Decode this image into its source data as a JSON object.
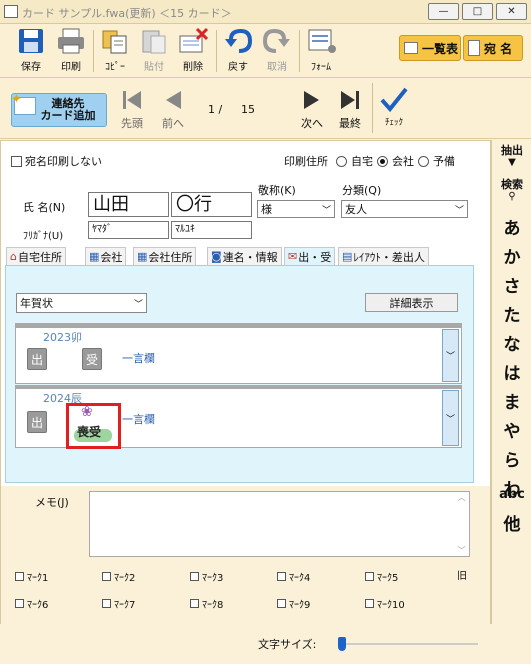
{
  "window": {
    "title": "カード サンプル.fwa(更新)  ＜15 カード＞",
    "min": "—",
    "max": "□",
    "close": "✕"
  },
  "toolbar": {
    "save": "保存",
    "print": "印刷",
    "copy": "ｺﾋﾟｰ",
    "paste": "貼付",
    "delete": "削除",
    "undo": "戻す",
    "redo": "取消",
    "form": "ﾌｫｰﾑ",
    "list_view": "一覧表",
    "address_name": "宛 名"
  },
  "nav": {
    "add_card": "連絡先\nカード追加",
    "first": "先頭",
    "prev": "前へ",
    "page": "1 /",
    "total": "15",
    "next": "次へ",
    "last": "最終",
    "check": "ﾁｪｯｸ"
  },
  "form": {
    "no_print_label": "宛名印刷しない",
    "print_address_label": "印刷住所",
    "print_address_options": [
      "自宅",
      "会社",
      "予備"
    ],
    "name_label": "氏 名(N)",
    "surname": "山田",
    "given": "〇行",
    "furigana_label": "ﾌﾘｶﾞﾅ(U)",
    "furigana_surname": "ﾔﾏﾀﾞ",
    "furigana_given": "ﾏﾙﾕｷ",
    "honorific_label": "敬称(K)",
    "honorific_value": "様",
    "category_label": "分類(Q)",
    "category_value": "友人"
  },
  "tabs": [
    "自宅住所",
    "会社",
    "会社住所",
    "連名・情報",
    "出・受",
    "ﾚｲｱｳﾄ・差出人"
  ],
  "greeting": {
    "type_value": "年賀状",
    "detail_button": "詳細表示",
    "entries": [
      {
        "year": "2023卯",
        "sent": "出",
        "received": "受",
        "note": "一言欄"
      },
      {
        "year": "2024辰",
        "sent": "出",
        "received": "喪受",
        "note": "一言欄"
      }
    ]
  },
  "memo": {
    "label": "メモ(J)",
    "value": ""
  },
  "marks": [
    "ﾏｰｸ1",
    "ﾏｰｸ2",
    "ﾏｰｸ3",
    "ﾏｰｸ4",
    "ﾏｰｸ5",
    "ﾏｰｸ6",
    "ﾏｰｸ7",
    "ﾏｰｸ8",
    "ﾏｰｸ9",
    "ﾏｰｸ10"
  ],
  "marks_side": "旧",
  "sidebar": {
    "extract": "抽出",
    "search": "検索",
    "kana": [
      "あ",
      "か",
      "さ",
      "た",
      "な",
      "は",
      "ま",
      "や",
      "ら",
      "わ",
      "abc",
      "他"
    ]
  },
  "footer": {
    "font_size_label": "文字サイズ:"
  },
  "colors": {
    "accent_blue": "#1e63c8",
    "highlight_red": "#e02020",
    "tab_bg": "#e0f5fb",
    "toolbar_bg": "#fbf0d3"
  }
}
